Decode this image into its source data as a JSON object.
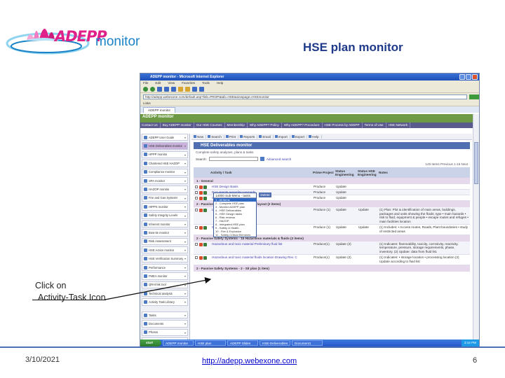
{
  "slide": {
    "logo_word": "ADEPP",
    "logo_suffix": "monitor",
    "title": "HSE plan monitor",
    "callout_line1": "Click on",
    "callout_line2": "Activity-Task Icon",
    "footer_date": "3/10/2021",
    "footer_url": "http://adepp.webexone.com",
    "footer_page": "6"
  },
  "browser": {
    "window_title": "ADEPP monitor - Microsoft Internet Explorer",
    "menu": [
      "File",
      "Edit",
      "View",
      "Favorites",
      "Tools",
      "Help"
    ],
    "address": "http://adepp.webexone.com/default.asp?link=PROP&tab=HSE&viewpage=HSEmonitor",
    "links_label": "Links",
    "tab_label": "ADEPP monitor"
  },
  "app": {
    "header": "ADEPP monitor",
    "nav": [
      "Contact Us",
      "Buy ADEPP monitor",
      "Our HSE Courses",
      "Membership",
      "Why ADEPP? Policy",
      "Why ADEPP? Procedure",
      "HSE Process by ADEPP",
      "Terms of Use",
      "HSE Network"
    ],
    "sidebar": [
      "ADEPP User Guide",
      "HSE Deliverables monitor",
      "HPPP monitor",
      "Chartered HSE HAZOP",
      "Compliance monitor",
      "SPA monitor",
      "HAZOP monitor",
      "Fire and Gas Systems",
      "HIPPS monitor",
      "Safety Integrity Levels",
      "Inherent monitor",
      "Bow-tie monitor",
      "Risk Assessment",
      "HSE Action monitor",
      "HSE Verification Summary",
      "Performance",
      "FMEA monitor",
      "QRA/risk tool",
      "Technical analysis",
      "Activity Task Library",
      "Tasks",
      "Documents",
      "Photos",
      "My Favorites"
    ],
    "actions": [
      "New",
      "Search",
      "Print",
      "Reports",
      "Email",
      "Import",
      "Export",
      "Help"
    ],
    "panel_title": "HSE Deliverables monitor",
    "panel_sub": "Complete safety analyses, plans & tasks",
    "search_label": "Search:",
    "advanced_label": "Advanced search",
    "count_text": "145 Items  Previous  1-15  Next",
    "columns": [
      "Activity / Task",
      "Prime Project",
      "Status Engineering",
      "Status HSE Engineering",
      "Notes"
    ],
    "dropdown_selected": "14000 Sub-Menu - tasks",
    "dropdown_options": [
      "1 - All items",
      "2 - Complete HSE plan",
      "3 - Monitor ADEPP plan",
      "4 - HSE Deliverables",
      "5 - HSE Design tasks",
      "6 - Risk reviews",
      "7 - HAZOP",
      "8 - Integrated HSE plan",
      "9 - Safety & Health",
      "10 - Fire & Explosion",
      "11 - Safety-Critical Elements"
    ],
    "dropdown_button": "Delete",
    "section1": "1 - General",
    "section2": "2 - Passive Safety Systems - 1 - Overall layout (2 items)",
    "section3": "2 - Passive Safety Systems - 1b Hazardous materials & fluids  (2 items)",
    "section4": "2 - Passive Safety Systems - 2 - Sit plan (1 item)",
    "rows": [
      {
        "activity": "HSE Design Basis",
        "prod": "Produce",
        "stat": "Update",
        "stat2": "",
        "notes": ""
      },
      {
        "activity": "Documents regarding Hazards",
        "prod": "Produce",
        "stat": "Update",
        "stat2": "",
        "notes": ""
      },
      {
        "activity": "General Specifications",
        "prod": "Produce",
        "stat": "Update",
        "stat2": "",
        "notes": ""
      },
      {
        "activity": "Layout",
        "prod": "Produce (1)",
        "stat": "Update",
        "stat2": "Update",
        "notes": "(1) Plan: Plot & identification of main areas, buildings, packages and units showing the fluids; type • main hazards • risk to fluid, equipment & people • escape routes and refuges • main facilities location"
      },
      {
        "activity": "Site Plot Plan",
        "prod": "Produce (1)",
        "stat": "Update",
        "stat2": "Update",
        "notes": "(1) Includes: • Access routes, Roads, Plant boundaries • study of restricted areas"
      },
      {
        "activity": "Hazardous and toxic material Preliminary fluid list",
        "prod": "Produce(1)",
        "stat": "Update (2)",
        "stat2": "",
        "notes": "(1) Indicates: flammability, toxicity, corrosivity, reactivity, temperature, pressure, storage requirements, phase, inventory. (2) Update: data from fluid list."
      },
      {
        "activity": "Hazardous and toxic material fluids location Drawing Rev. C",
        "prod": "Produce(1)",
        "stat": "Update (2)",
        "stat2": "",
        "notes": "(1) Indicates: • storage location • processing location (2) Update according to fluid list"
      }
    ]
  },
  "taskbar": {
    "start": "start",
    "tasks": [
      "ADEPP monitor",
      "HSE plan",
      "ADEPP Slides",
      "HSE-Deliverables",
      "Document1"
    ],
    "clock": "3:14 PM"
  },
  "colors": {
    "slide_title": "#1f3a8a",
    "logo_pink": "#e0218a",
    "logo_blue": "#1a82c7",
    "app_header": "#6f9a45",
    "panel_title": "#4f6fb0",
    "section_bg": "#e6d9ec",
    "footer_line": "#4a6fb5",
    "url": "#0000cc"
  }
}
